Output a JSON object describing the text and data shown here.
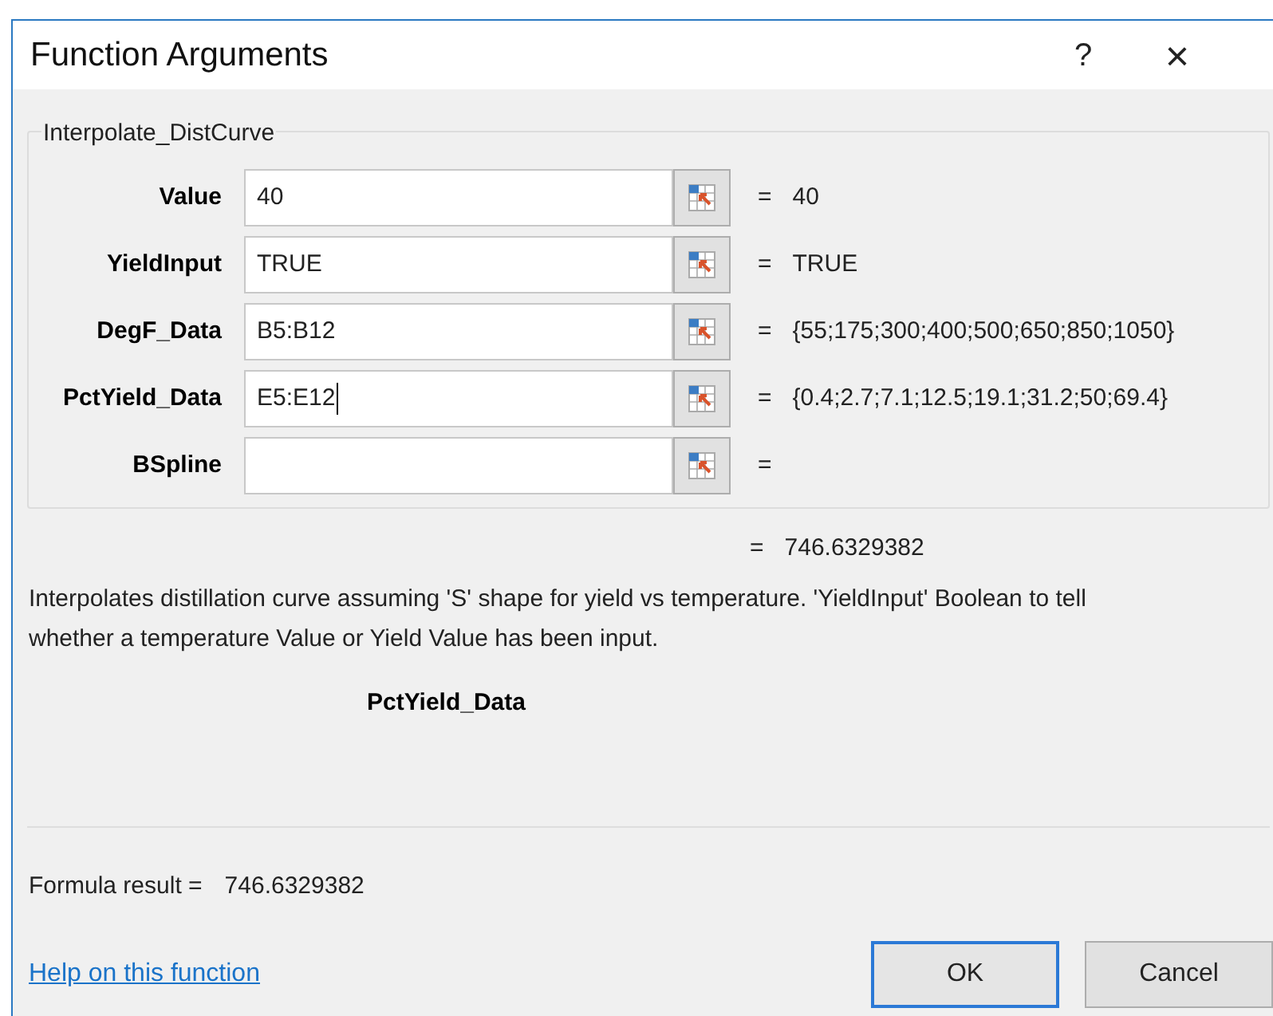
{
  "window": {
    "title": "Function Arguments",
    "help_glyph": "?",
    "close_glyph": "×"
  },
  "function": {
    "name": "Interpolate_DistCurve",
    "arguments": [
      {
        "label": "Value",
        "value": "40",
        "result": "40",
        "focused": false
      },
      {
        "label": "YieldInput",
        "value": "TRUE",
        "result": "TRUE",
        "focused": false
      },
      {
        "label": "DegF_Data",
        "value": "B5:B12",
        "result": "{55;175;300;400;500;650;850;1050}",
        "focused": false
      },
      {
        "label": "PctYield_Data",
        "value": "E5:E12",
        "result": "{0.4;2.7;7.1;12.5;19.1;31.2;50;69.4}",
        "focused": true
      },
      {
        "label": "BSpline",
        "focused": false
      }
    ],
    "equals": "=",
    "result": "746.6329382",
    "description": "Interpolates distillation curve assuming 'S' shape for yield vs temperature. 'YieldInput' Boolean to tell whether a temperature Value or Yield Value has been input.",
    "current_argument": "PctYield_Data"
  },
  "formula_result": {
    "label": "Formula result =",
    "value": "746.6329382"
  },
  "help_link": "Help on this function",
  "buttons": [
    {
      "label": "OK",
      "default": true
    },
    {
      "label": "Cancel",
      "default": false
    }
  ]
}
